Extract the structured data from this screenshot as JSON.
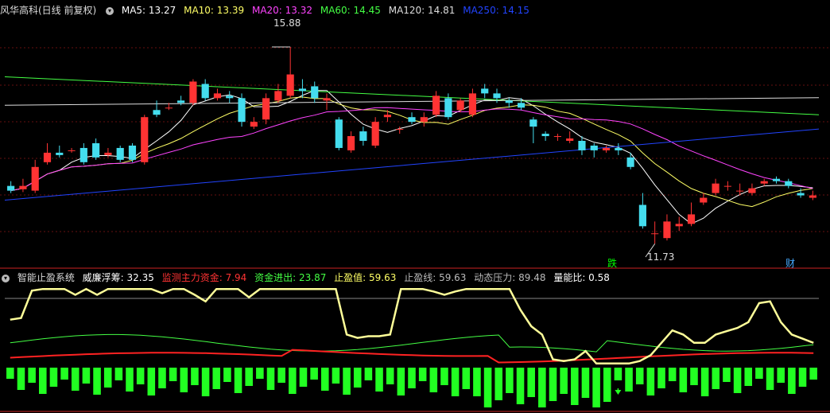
{
  "main_panel": {
    "title": "风华高科(日线 前复权)",
    "ma": [
      {
        "label": "MA5: 13.27",
        "color": "#ffffff"
      },
      {
        "label": "MA10: 13.39",
        "color": "#ffff66"
      },
      {
        "label": "MA20: 13.32",
        "color": "#ff44ff"
      },
      {
        "label": "MA60: 14.45",
        "color": "#44ff44"
      },
      {
        "label": "MA120: 14.81",
        "color": "#dddddd"
      },
      {
        "label": "MA250: 14.15",
        "color": "#2244ff"
      }
    ],
    "high_label": "15.88",
    "low_label": "11.73",
    "signals": [
      {
        "text": "跌",
        "color": "#00ff00"
      },
      {
        "text": "财",
        "color": "#44aaff"
      }
    ]
  },
  "indicator_panel": {
    "title": "智能止盈系统",
    "items": [
      {
        "label": "威廉浮筹: 32.35",
        "color": "#ffffff"
      },
      {
        "label": "监测主力资金: 7.94",
        "color": "#ff3333"
      },
      {
        "label": "资金进出: 23.87",
        "color": "#44ff44"
      },
      {
        "label": "止盈值: 59.63",
        "color": "#ffff66"
      },
      {
        "label": "止盈线: 59.63",
        "color": "#bbbbbb"
      },
      {
        "label": "动态压力: 89.48",
        "color": "#bbbbbb"
      },
      {
        "label": "量能比: 0.58",
        "color": "#ffffff"
      }
    ]
  },
  "chart_data": {
    "type": "candlestick",
    "y_range": [
      11.3,
      16.5
    ],
    "candles": [
      [
        12.95,
        12.85,
        13.05,
        12.8
      ],
      [
        12.88,
        12.95,
        13.1,
        12.82
      ],
      [
        12.85,
        13.35,
        13.5,
        12.8
      ],
      [
        13.45,
        13.65,
        13.85,
        13.4
      ],
      [
        13.65,
        13.6,
        13.8,
        13.55
      ],
      [
        13.7,
        13.7,
        13.75,
        13.65
      ],
      [
        13.75,
        13.45,
        13.85,
        13.4
      ],
      [
        13.85,
        13.55,
        13.95,
        13.5
      ],
      [
        13.6,
        13.65,
        13.75,
        13.55
      ],
      [
        13.75,
        13.5,
        13.8,
        13.45
      ],
      [
        13.8,
        13.5,
        13.85,
        13.45
      ],
      [
        13.45,
        14.4,
        14.45,
        13.4
      ],
      [
        14.55,
        14.45,
        14.75,
        14.4
      ],
      [
        14.6,
        14.6,
        14.7,
        14.55
      ],
      [
        14.75,
        14.7,
        14.85,
        14.65
      ],
      [
        14.7,
        15.15,
        15.2,
        14.65
      ],
      [
        15.1,
        14.8,
        15.2,
        14.75
      ],
      [
        14.8,
        14.9,
        15.0,
        14.75
      ],
      [
        14.85,
        14.8,
        14.95,
        14.7
      ],
      [
        14.8,
        14.3,
        14.9,
        14.2
      ],
      [
        14.2,
        14.3,
        14.4,
        14.15
      ],
      [
        14.35,
        14.8,
        14.9,
        14.25
      ],
      [
        14.75,
        14.95,
        15.1,
        14.7
      ],
      [
        14.85,
        15.3,
        15.88,
        14.8
      ],
      [
        15.0,
        14.95,
        15.2,
        14.8
      ],
      [
        15.05,
        14.8,
        15.15,
        14.7
      ],
      [
        14.75,
        14.8,
        14.9,
        14.55
      ],
      [
        14.35,
        13.75,
        14.4,
        13.7
      ],
      [
        13.7,
        14.0,
        14.1,
        13.65
      ],
      [
        14.1,
        13.9,
        14.2,
        13.8
      ],
      [
        13.8,
        14.3,
        14.4,
        13.75
      ],
      [
        14.4,
        14.45,
        14.55,
        14.3
      ],
      [
        14.15,
        14.15,
        14.2,
        14.05
      ],
      [
        14.4,
        14.3,
        14.5,
        14.25
      ],
      [
        14.3,
        14.4,
        14.5,
        14.2
      ],
      [
        14.45,
        14.85,
        14.95,
        14.4
      ],
      [
        14.8,
        14.4,
        14.9,
        14.35
      ],
      [
        14.55,
        14.75,
        14.8,
        14.5
      ],
      [
        14.45,
        14.9,
        15.0,
        14.4
      ],
      [
        15.0,
        14.9,
        15.1,
        14.8
      ],
      [
        14.9,
        14.8,
        15.0,
        14.7
      ],
      [
        14.75,
        14.7,
        14.8,
        14.6
      ],
      [
        14.7,
        14.6,
        14.8,
        14.55
      ],
      [
        14.35,
        14.2,
        14.4,
        13.85
      ],
      [
        14.05,
        14.0,
        14.1,
        13.9
      ],
      [
        14.0,
        14.0,
        14.05,
        13.9
      ],
      [
        13.9,
        13.95,
        14.1,
        13.85
      ],
      [
        13.9,
        13.7,
        14.0,
        13.6
      ],
      [
        13.8,
        13.7,
        13.85,
        13.55
      ],
      [
        13.7,
        13.75,
        13.8,
        13.65
      ],
      [
        13.75,
        13.7,
        13.85,
        13.6
      ],
      [
        13.55,
        13.35,
        13.65,
        13.3
      ],
      [
        12.55,
        12.1,
        12.8,
        12.05
      ],
      [
        11.95,
        11.95,
        12.2,
        11.73
      ],
      [
        11.85,
        12.2,
        12.35,
        11.8
      ],
      [
        12.1,
        12.15,
        12.3,
        12.0
      ],
      [
        12.15,
        12.35,
        12.6,
        12.1
      ],
      [
        12.6,
        12.7,
        12.8,
        12.55
      ],
      [
        12.8,
        13.0,
        13.1,
        12.75
      ],
      [
        12.95,
        12.95,
        13.05,
        12.85
      ],
      [
        12.85,
        12.85,
        13.0,
        12.75
      ],
      [
        12.8,
        12.9,
        13.0,
        12.75
      ],
      [
        13.0,
        13.05,
        13.1,
        12.95
      ],
      [
        13.1,
        13.05,
        13.15,
        13.0
      ],
      [
        13.05,
        12.95,
        13.1,
        12.9
      ],
      [
        12.8,
        12.75,
        12.9,
        12.7
      ],
      [
        12.7,
        12.75,
        12.85,
        12.65
      ]
    ],
    "candle_colors": {
      "up": "#ff3333",
      "down": "#44ddee"
    },
    "indicator": {
      "y_range": [
        0,
        100
      ],
      "wm_float": [
        58,
        60,
        93,
        95,
        95,
        95,
        88,
        95,
        88,
        95,
        95,
        95,
        95,
        95,
        90,
        95,
        95,
        88,
        80,
        95,
        95,
        95,
        85,
        95,
        95,
        95,
        95,
        95,
        95,
        95,
        95,
        40,
        36,
        38,
        38,
        40,
        95,
        95,
        95,
        92,
        88,
        92,
        95,
        95,
        95,
        95,
        95,
        70,
        50,
        40,
        10,
        8,
        10,
        20,
        5,
        5,
        5,
        5,
        8,
        15,
        30,
        45,
        40,
        30,
        30,
        40,
        44,
        48,
        55,
        78,
        80,
        55,
        40,
        35,
        30
      ]
    }
  }
}
